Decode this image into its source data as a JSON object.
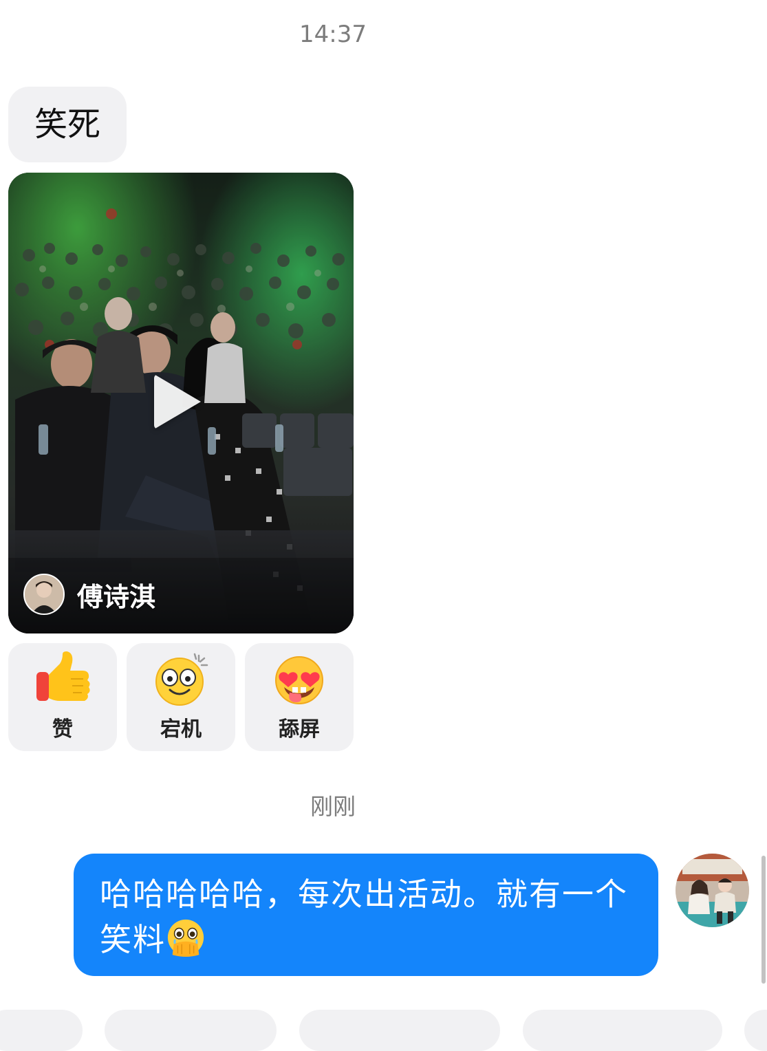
{
  "timestamps": {
    "first": "14:37",
    "second": "刚刚"
  },
  "incoming_message": {
    "text": "笑死"
  },
  "video_share": {
    "author_name": "傅诗淇",
    "play_icon": "play-icon"
  },
  "reactions": [
    {
      "label": "赞",
      "icon": "thumbs-up-icon"
    },
    {
      "label": "宕机",
      "icon": "dizzy-face-icon"
    },
    {
      "label": "舔屏",
      "icon": "heart-eyes-tongue-icon"
    }
  ],
  "outgoing_message": {
    "text": "哈哈哈哈哈，每次出活动。就有一个笑料",
    "emoji": "holding-back-tears-icon"
  },
  "colors": {
    "outgoing_bubble": "#1485fb",
    "incoming_bubble": "#f1f1f3",
    "timestamp": "#7c7c7c"
  }
}
